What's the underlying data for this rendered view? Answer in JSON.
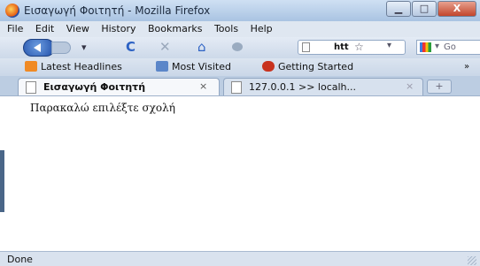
{
  "window": {
    "title": "Εισαγωγή Φοιτητή - Mozilla Firefox",
    "controls": {
      "minimize": "▁",
      "maximize": "□",
      "close": "X"
    }
  },
  "menu": [
    "File",
    "Edit",
    "View",
    "History",
    "Bookmarks",
    "Tools",
    "Help"
  ],
  "nav": {
    "reload_icon": "C",
    "stop_icon": "✕",
    "home_icon": "⌂",
    "url_text": "htt",
    "star": "☆",
    "dropdown": "▾",
    "search_text": "Go"
  },
  "bookmarks": [
    {
      "label": "Latest Headlines",
      "icon": "rss-icon",
      "color": "#f08a24"
    },
    {
      "label": "Most Visited",
      "icon": "most-visited-icon",
      "color": "#5b86c9"
    },
    {
      "label": "Getting Started",
      "icon": "getting-started-icon",
      "color": "#c8321e"
    }
  ],
  "bookmarks_overflow": "»",
  "tabs": [
    {
      "label": "Εισαγωγή Φοιτητή",
      "close": "×"
    },
    {
      "label": "127.0.0.1 >> localh...",
      "close": "×"
    }
  ],
  "new_tab": "+",
  "page": {
    "message": "Παρακαλώ επιλέξτε σχολή"
  },
  "status": "Done"
}
